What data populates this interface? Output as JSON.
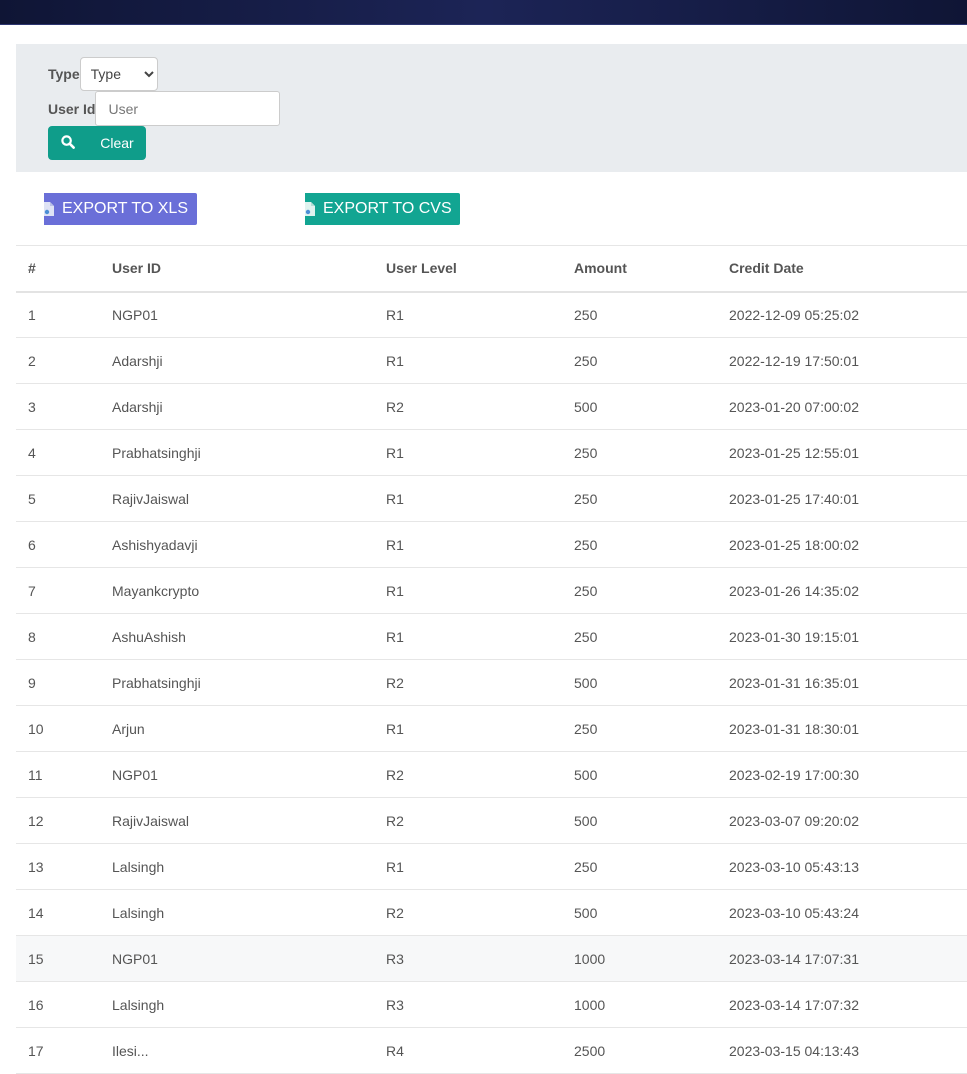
{
  "filters": {
    "type_label": "Type",
    "type_selected": "Type",
    "userid_label": "User Id",
    "userid_placeholder": "User",
    "userid_value": "",
    "search_icon": "search-icon",
    "clear_label": "Clear"
  },
  "exports": {
    "xls_label": "EXPORT TO XLS",
    "cvs_label": "EXPORT TO CVS",
    "xls_color": "#6a6fd8",
    "cvs_color": "#12a592"
  },
  "table": {
    "headers": [
      "#",
      "User ID",
      "User Level",
      "Amount",
      "Credit Date"
    ],
    "rows": [
      [
        "1",
        "NGP01",
        "R1",
        "250",
        "2022-12-09 05:25:02"
      ],
      [
        "2",
        "Adarshji",
        "R1",
        "250",
        "2022-12-19 17:50:01"
      ],
      [
        "3",
        "Adarshji",
        "R2",
        "500",
        "2023-01-20 07:00:02"
      ],
      [
        "4",
        "Prabhatsinghji",
        "R1",
        "250",
        "2023-01-25 12:55:01"
      ],
      [
        "5",
        "RajivJaiswal",
        "R1",
        "250",
        "2023-01-25 17:40:01"
      ],
      [
        "6",
        "Ashishyadavji",
        "R1",
        "250",
        "2023-01-25 18:00:02"
      ],
      [
        "7",
        "Mayankcrypto",
        "R1",
        "250",
        "2023-01-26 14:35:02"
      ],
      [
        "8",
        "AshuAshish",
        "R1",
        "250",
        "2023-01-30 19:15:01"
      ],
      [
        "9",
        "Prabhatsinghji",
        "R2",
        "500",
        "2023-01-31 16:35:01"
      ],
      [
        "10",
        "Arjun",
        "R1",
        "250",
        "2023-01-31 18:30:01"
      ],
      [
        "11",
        "NGP01",
        "R2",
        "500",
        "2023-02-19 17:00:30"
      ],
      [
        "12",
        "RajivJaiswal",
        "R2",
        "500",
        "2023-03-07 09:20:02"
      ],
      [
        "13",
        "Lalsingh",
        "R1",
        "250",
        "2023-03-10 05:43:13"
      ],
      [
        "14",
        "Lalsingh",
        "R2",
        "500",
        "2023-03-10 05:43:24"
      ],
      [
        "15",
        "NGP01",
        "R3",
        "1000",
        "2023-03-14 17:07:31"
      ],
      [
        "16",
        "Lalsingh",
        "R3",
        "1000",
        "2023-03-14 17:07:32"
      ],
      [
        "17",
        "Ilesi...",
        "R4",
        "2500",
        "2023-03-15 04:13:43"
      ]
    ],
    "highlighted_row": 15
  }
}
